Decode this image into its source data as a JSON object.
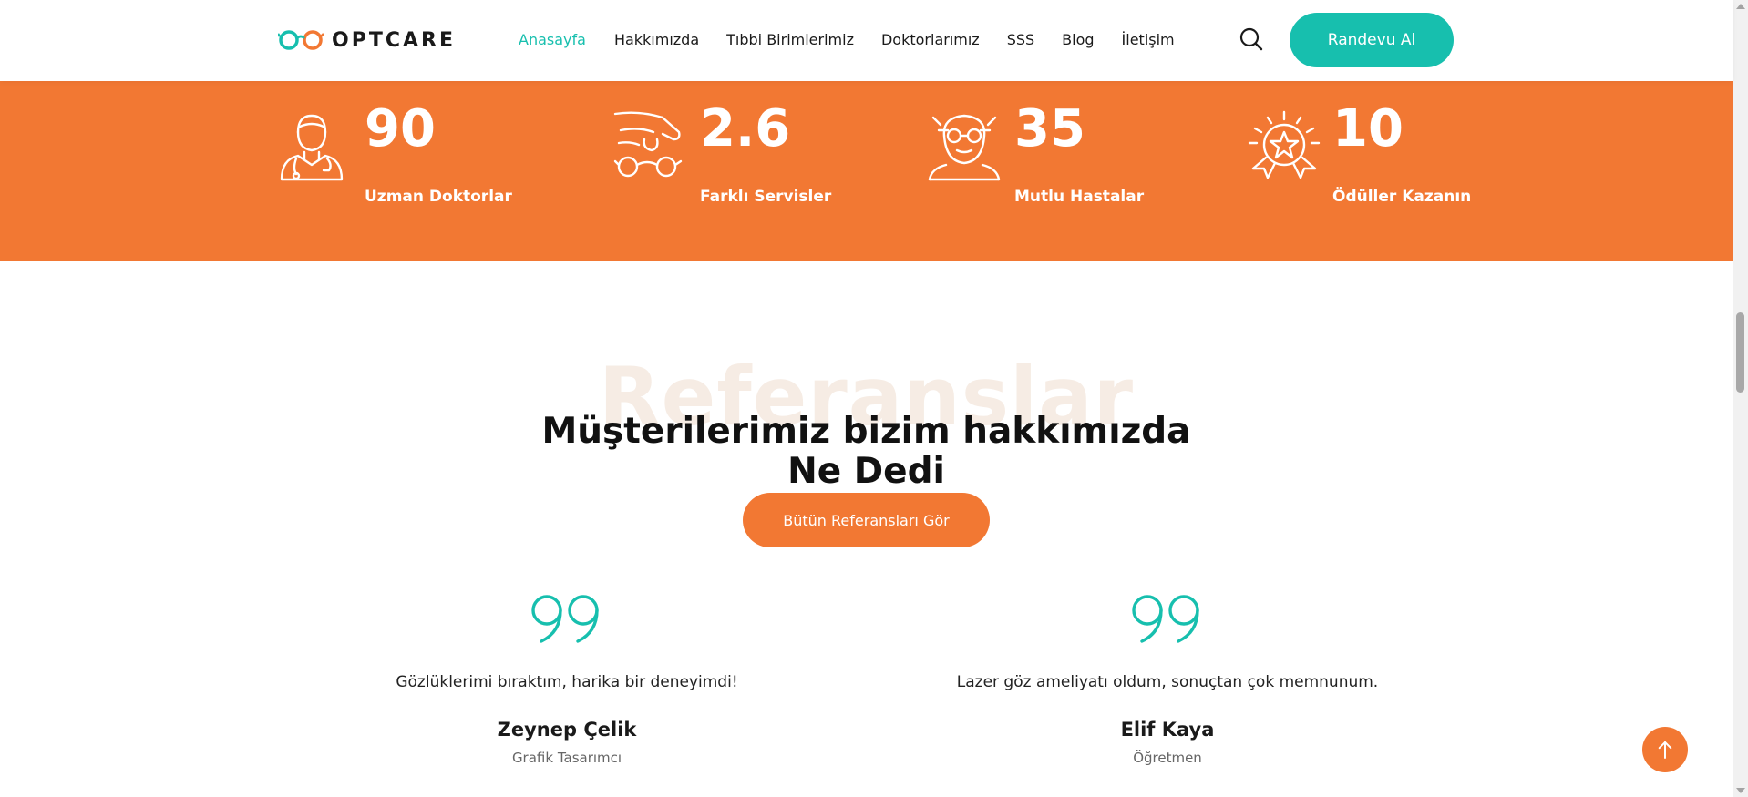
{
  "header": {
    "logo_text": "OPTCARE",
    "nav": [
      "Anasayfa",
      "Hakkımızda",
      "Tıbbi Birimlerimiz",
      "Doktorlarımız",
      "SSS",
      "Blog",
      "İletişim"
    ],
    "active_nav": "Anasayfa",
    "cta_label": "Randevu Al"
  },
  "stats": [
    {
      "value": "90",
      "label": "Uzman Doktorlar",
      "icon": "doctor-icon"
    },
    {
      "value": "2.6",
      "label": "Farklı Servisler",
      "icon": "glasses-hand-icon"
    },
    {
      "value": "35",
      "label": "Mutlu Hastalar",
      "icon": "patient-eye-test-icon"
    },
    {
      "value": "10",
      "label": "Ödüller Kazanın",
      "icon": "award-icon"
    }
  ],
  "testimonials": {
    "background_title": "Referanslar",
    "title_line1": "Müşterilerimiz bizim hakkımızda",
    "title_line2": "Ne Dedi",
    "button_label": "Bütün Referansları Gör",
    "items": [
      {
        "quote": "Gözlüklerimi bıraktım, harika bir deneyimdi!",
        "name": "Zeynep Çelik",
        "role": "Grafik Tasarımcı"
      },
      {
        "quote": "Lazer göz ameliyatı oldum, sonuçtan çok memnunum.",
        "name": "Elif Kaya",
        "role": "Öğretmen"
      }
    ]
  },
  "colors": {
    "accent_teal": "#17bfae",
    "accent_orange": "#f27833"
  }
}
